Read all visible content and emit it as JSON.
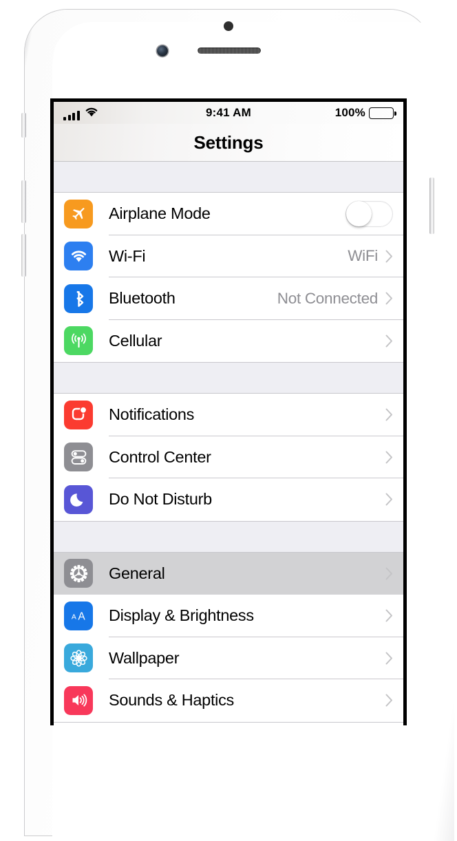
{
  "device": {
    "model_appearance": "white-iphone",
    "hardware": {
      "earpiece": "speaker-grille",
      "front_camera": "front-camera",
      "proximity_sensor": "proximity-sensor",
      "silent_switch": "silent-switch",
      "volume_up": "volume-up-button",
      "volume_down": "volume-down-button",
      "power": "power-button"
    }
  },
  "status_bar": {
    "signal_icon": "cellular-signal-icon",
    "signal_bars": 4,
    "wifi_icon": "wifi-icon",
    "time": "9:41 AM",
    "battery_percent": "100%",
    "battery_icon": "battery-icon",
    "battery_level": 100
  },
  "nav": {
    "title": "Settings"
  },
  "colors": {
    "airplane": "#f79a1f",
    "wifi": "#2d7ff0",
    "bluetooth": "#1777e8",
    "cellular": "#4cd862",
    "notifications": "#fb3b30",
    "control_center": "#8e8e93",
    "do_not_disturb": "#5856d6",
    "general": "#8e8e93",
    "display": "#1777e8",
    "wallpaper": "#39a9dc",
    "sounds": "#f8385a",
    "selected_row": "#d2d2d4",
    "section_gap": "#eeeef3",
    "separator": "#c8c7cc",
    "secondary_text": "#8e8e93"
  },
  "sections": [
    {
      "id": "connectivity",
      "rows": [
        {
          "id": "airplane-mode",
          "label": "Airplane Mode",
          "icon": "airplane-icon",
          "accessory": "toggle",
          "toggle_on": false,
          "value": "",
          "selected": false
        },
        {
          "id": "wi-fi",
          "label": "Wi-Fi",
          "icon": "wifi-icon",
          "accessory": "chevron",
          "value": "WiFi",
          "selected": false
        },
        {
          "id": "bluetooth",
          "label": "Bluetooth",
          "icon": "bluetooth-icon",
          "accessory": "chevron",
          "value": "Not Connected",
          "selected": false
        },
        {
          "id": "cellular",
          "label": "Cellular",
          "icon": "cellular-icon",
          "accessory": "chevron",
          "value": "",
          "selected": false
        }
      ]
    },
    {
      "id": "alerts",
      "rows": [
        {
          "id": "notifications",
          "label": "Notifications",
          "icon": "notifications-icon",
          "accessory": "chevron",
          "value": "",
          "selected": false
        },
        {
          "id": "control-center",
          "label": "Control Center",
          "icon": "control-center-icon",
          "accessory": "chevron",
          "value": "",
          "selected": false
        },
        {
          "id": "do-not-disturb",
          "label": "Do Not Disturb",
          "icon": "moon-icon",
          "accessory": "chevron",
          "value": "",
          "selected": false
        }
      ]
    },
    {
      "id": "system",
      "rows": [
        {
          "id": "general",
          "label": "General",
          "icon": "gear-icon",
          "accessory": "chevron",
          "value": "",
          "selected": true
        },
        {
          "id": "display-brightness",
          "label": "Display & Brightness",
          "icon": "text-size-icon",
          "accessory": "chevron",
          "value": "",
          "selected": false
        },
        {
          "id": "wallpaper",
          "label": "Wallpaper",
          "icon": "flower-icon",
          "accessory": "chevron",
          "value": "",
          "selected": false
        },
        {
          "id": "sounds-haptics",
          "label": "Sounds & Haptics",
          "icon": "speaker-icon",
          "accessory": "chevron",
          "value": "",
          "selected": false
        }
      ]
    }
  ]
}
